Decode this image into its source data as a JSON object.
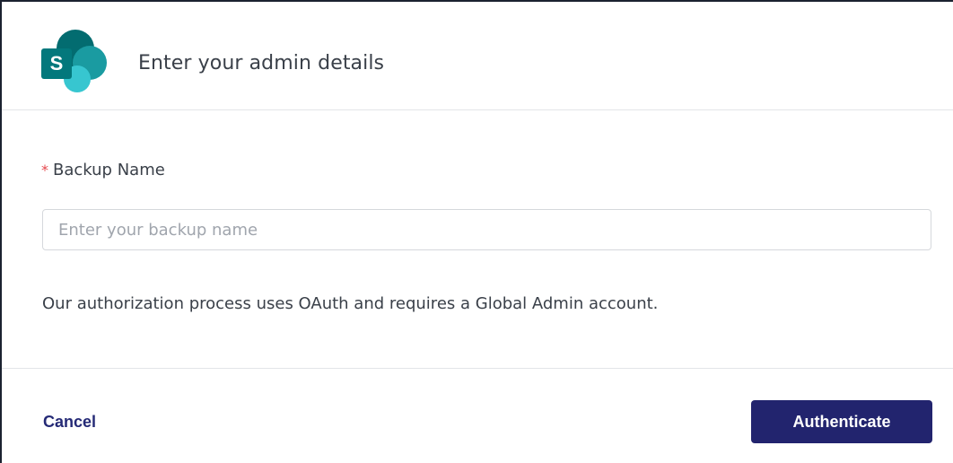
{
  "header": {
    "title": "Enter your admin details",
    "logo_icon": "sharepoint-icon",
    "logo_letter": "S",
    "colors": {
      "dark_teal": "#036c70",
      "mid_teal": "#1a9ba1",
      "light_teal": "#37c6d0"
    }
  },
  "form": {
    "required_marker": "*",
    "backup_name_label": "Backup Name",
    "backup_name_value": "",
    "backup_name_placeholder": "Enter your backup name",
    "help_text": "Our authorization process uses OAuth and requires a Global Admin account."
  },
  "footer": {
    "cancel_label": "Cancel",
    "authenticate_label": "Authenticate",
    "primary_color": "#22246e"
  }
}
